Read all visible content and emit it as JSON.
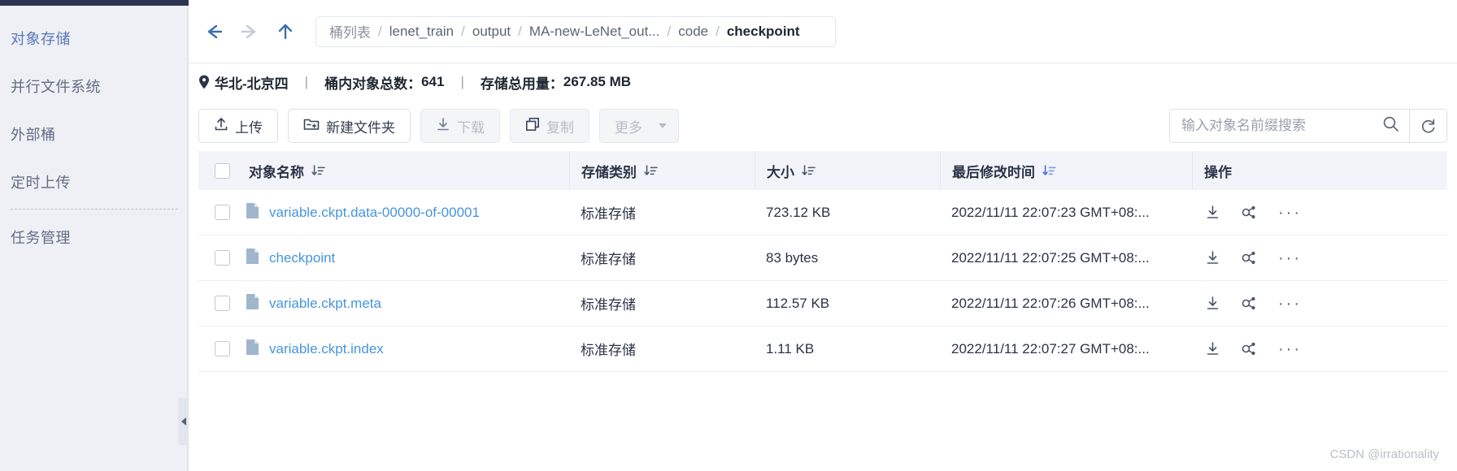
{
  "sidebar": {
    "items": [
      {
        "label": "对象存储",
        "active": true
      },
      {
        "label": "并行文件系统",
        "active": false
      },
      {
        "label": "外部桶",
        "active": false
      },
      {
        "label": "定时上传",
        "active": false
      },
      {
        "label": "任务管理",
        "active": false
      }
    ]
  },
  "nav": {
    "back_icon": "arrow-left-icon",
    "forward_icon": "arrow-right-icon",
    "up_icon": "arrow-up-icon"
  },
  "breadcrumb": {
    "items": [
      {
        "label": "桶列表",
        "current": false
      },
      {
        "label": "lenet_train",
        "current": false
      },
      {
        "label": "output",
        "current": false
      },
      {
        "label": "MA-new-LeNet_out...",
        "current": false
      },
      {
        "label": "code",
        "current": false
      },
      {
        "label": "checkpoint",
        "current": true
      }
    ],
    "separator": "/"
  },
  "info": {
    "region": "华北-北京四",
    "object_count_label": "桶内对象总数：",
    "object_count_value": "641",
    "storage_label": "存储总用量：",
    "storage_value": "267.85 MB",
    "separator": "|"
  },
  "toolbar": {
    "upload": "上传",
    "new_folder": "新建文件夹",
    "download": "下载",
    "copy": "复制",
    "more": "更多"
  },
  "search": {
    "value": "",
    "placeholder": "输入对象名前缀搜索",
    "search_icon": "search-icon",
    "refresh_icon": "refresh-icon"
  },
  "table": {
    "headers": {
      "name": "对象名称",
      "storage_class": "存储类别",
      "size": "大小",
      "last_modified": "最后修改时间",
      "actions": "操作"
    },
    "sort_icon": "sort-icon",
    "rows": [
      {
        "name": "variable.ckpt.data-00000-of-00001",
        "storage_class": "标准存储",
        "size": "723.12 KB",
        "last_modified": "2022/11/11 22:07:23 GMT+08:..."
      },
      {
        "name": "checkpoint",
        "storage_class": "标准存储",
        "size": "83 bytes",
        "last_modified": "2022/11/11 22:07:25 GMT+08:..."
      },
      {
        "name": "variable.ckpt.meta",
        "storage_class": "标准存储",
        "size": "112.57 KB",
        "last_modified": "2022/11/11 22:07:26 GMT+08:..."
      },
      {
        "name": "variable.ckpt.index",
        "storage_class": "标准存储",
        "size": "1.11 KB",
        "last_modified": "2022/11/11 22:07:27 GMT+08:..."
      }
    ],
    "row_actions": {
      "download_icon": "download-icon",
      "share_icon": "share-icon",
      "more_icon": "more-horizontal-icon"
    }
  },
  "watermark": "CSDN @irrationality",
  "colors": {
    "accent": "#5976ba",
    "link": "#4594e0",
    "header_bg": "#f2f4fa",
    "sidebar_bg": "#eef0f5",
    "topstrip": "#2e3553"
  }
}
